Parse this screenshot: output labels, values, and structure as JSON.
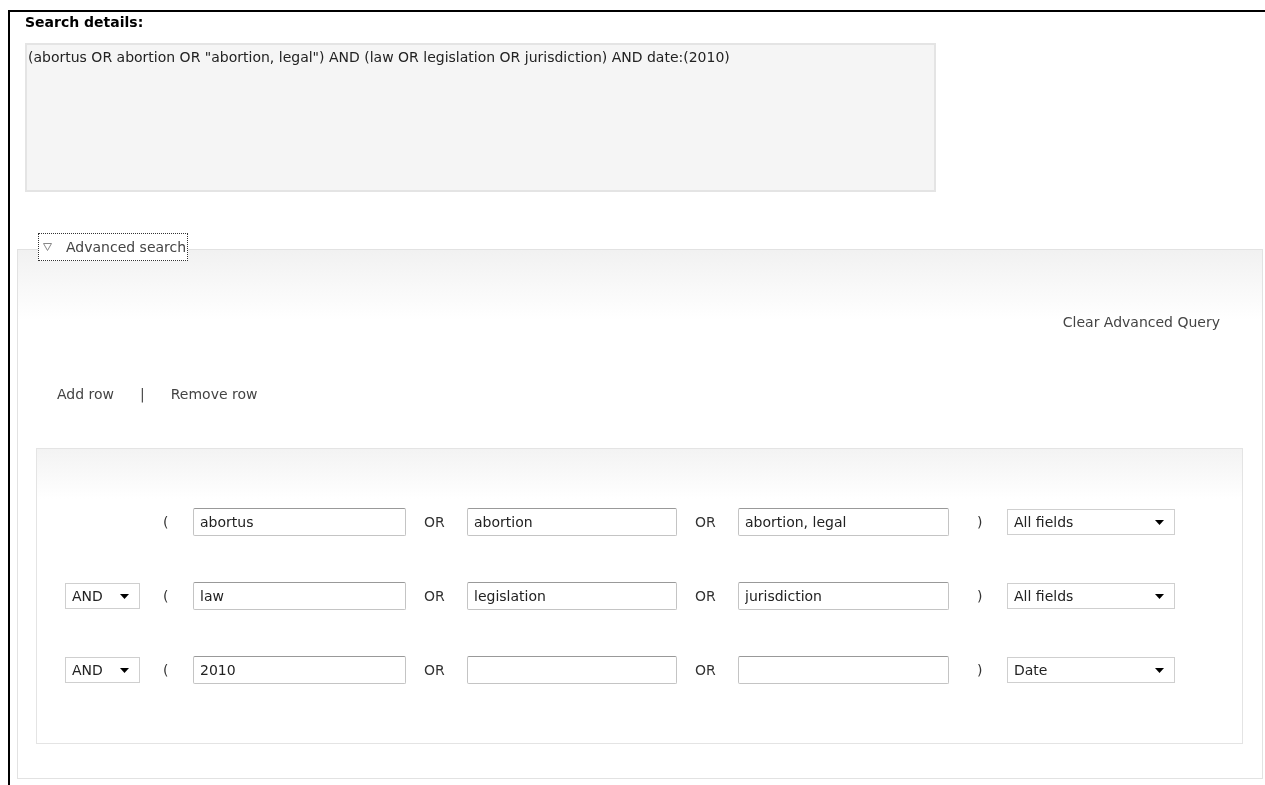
{
  "search_details": {
    "label": "Search details:",
    "query": "(abortus OR abortion OR \"abortion, legal\") AND (law OR legislation OR jurisdiction) AND date:(2010)"
  },
  "advanced_search": {
    "title": "Advanced search",
    "expanded": true,
    "clear_link": "Clear Advanced Query",
    "add_row": "Add row",
    "separator": "|",
    "remove_row": "Remove row",
    "rows": [
      {
        "open": "(",
        "terms": [
          "abortus",
          "abortion",
          "abortion, legal"
        ],
        "operators": [
          "OR",
          "OR"
        ],
        "close": ")",
        "field": "All fields"
      },
      {
        "connector": "AND",
        "open": "(",
        "terms": [
          "law",
          "legislation",
          "jurisdiction"
        ],
        "operators": [
          "OR",
          "OR"
        ],
        "close": ")",
        "field": "All fields"
      },
      {
        "connector": "AND",
        "open": "(",
        "terms": [
          "2010"
        ],
        "operators": [
          "OR",
          "OR"
        ],
        "close": ")",
        "field": "Date"
      }
    ]
  }
}
